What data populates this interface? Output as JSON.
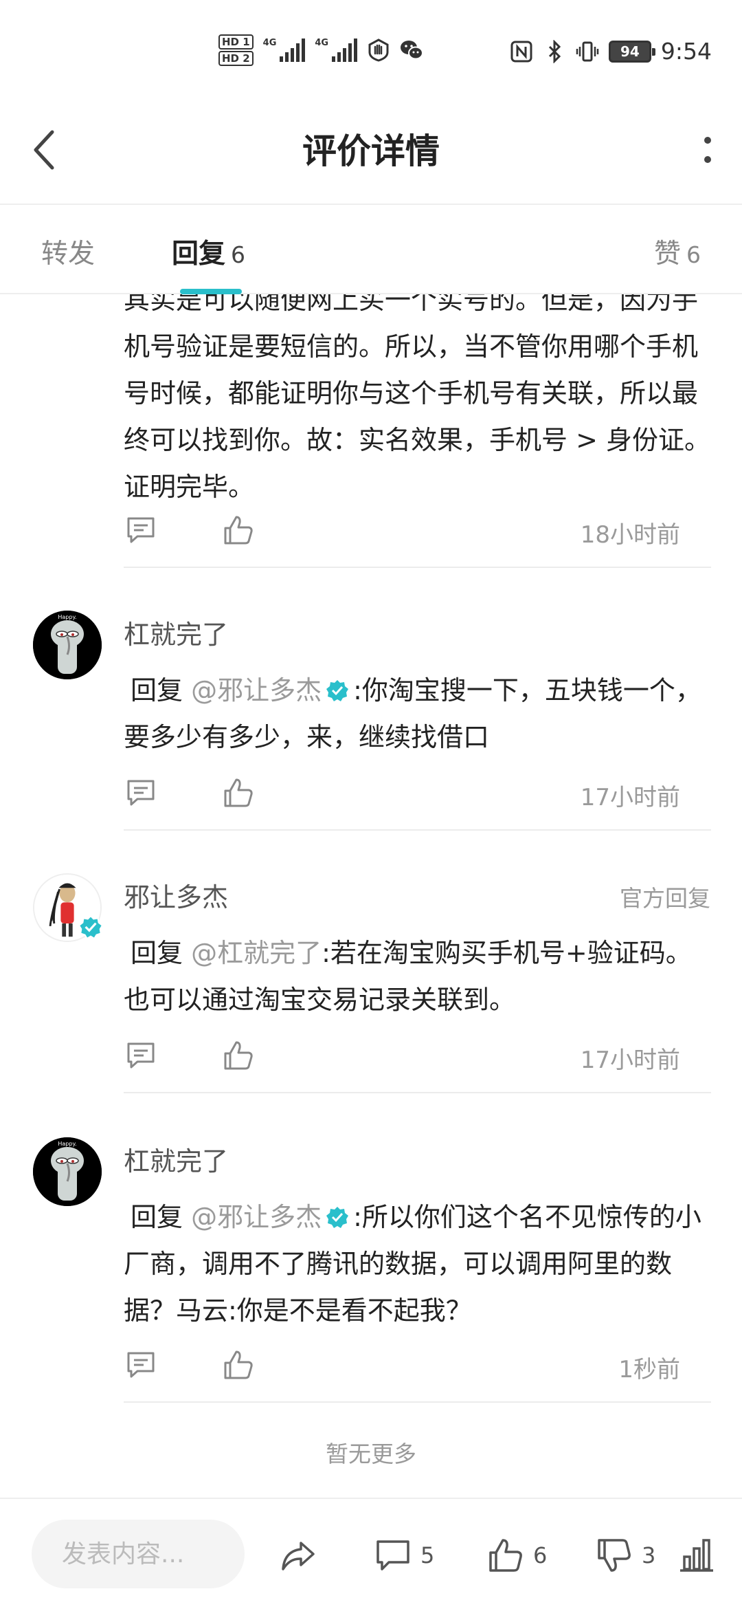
{
  "status_bar": {
    "hd1": "HD 1",
    "hd2": "HD 2",
    "sig1_label": "4G",
    "sig2_label": "4G",
    "battery": "94",
    "time": "9:54"
  },
  "header": {
    "title": "评价详情"
  },
  "tabs": {
    "forward_label": "转发",
    "reply_label": "回复",
    "reply_count": "6",
    "like_label": "赞",
    "like_count": "6"
  },
  "comments": [
    {
      "text": "其实是可以随便网上买一个实号的。但是，因为手机号验证是要短信的。所以，当不管你用哪个手机号时候，都能证明你与这个手机号有关联，所以最终可以找到你。故：实名效果，手机号 > 身份证。证明完毕。",
      "time": "18小时前"
    },
    {
      "user": "杠就完了",
      "reply_prefix": "回复",
      "mention": "@邪让多杰",
      "text": ":你淘宝搜一下，五块钱一个，要多少有多少，来，继续找借口",
      "time": "17小时前"
    },
    {
      "user": "邪让多杰",
      "official": "官方回复",
      "reply_prefix": "回复",
      "mention": "@杠就完了",
      "text": ":若在淘宝购买手机号+验证码。也可以通过淘宝交易记录关联到。",
      "time": "17小时前"
    },
    {
      "user": "杠就完了",
      "reply_prefix": "回复",
      "mention": "@邪让多杰",
      "text": ":所以你们这个名不见惊传的小厂商，调用不了腾讯的数据，可以调用阿里的数据？马云:你是不是看不起我？",
      "time": "1秒前"
    }
  ],
  "footer_note": "暂无更多",
  "bottom_bar": {
    "compose_placeholder": "发表内容...",
    "comment_count": "5",
    "like_count": "6",
    "dislike_count": "3"
  },
  "colors": {
    "accent": "#2abfcb",
    "muted": "#9a9a9a",
    "text": "#222222"
  }
}
